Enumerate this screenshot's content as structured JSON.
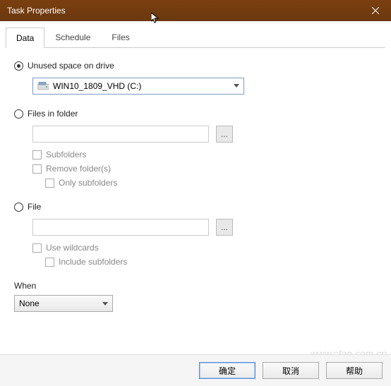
{
  "window": {
    "title": "Task Properties"
  },
  "tabs": {
    "data": "Data",
    "schedule": "Schedule",
    "files": "Files"
  },
  "options": {
    "unused_space": {
      "label": "Unused space on drive",
      "drive": "WIN10_1809_VHD (C:)"
    },
    "files_folder": {
      "label": "Files in folder",
      "value": "",
      "browse": "...",
      "subfolders": "Subfolders",
      "remove_folders": "Remove folder(s)",
      "only_subfolders": "Only subfolders"
    },
    "file": {
      "label": "File",
      "value": "",
      "browse": "...",
      "use_wildcards": "Use wildcards",
      "include_subfolders": "Include subfolders"
    }
  },
  "when": {
    "label": "When",
    "value": "None"
  },
  "buttons": {
    "ok": "确定",
    "cancel": "取消",
    "help": "帮助"
  },
  "watermark": "www.cfan.com.cn"
}
